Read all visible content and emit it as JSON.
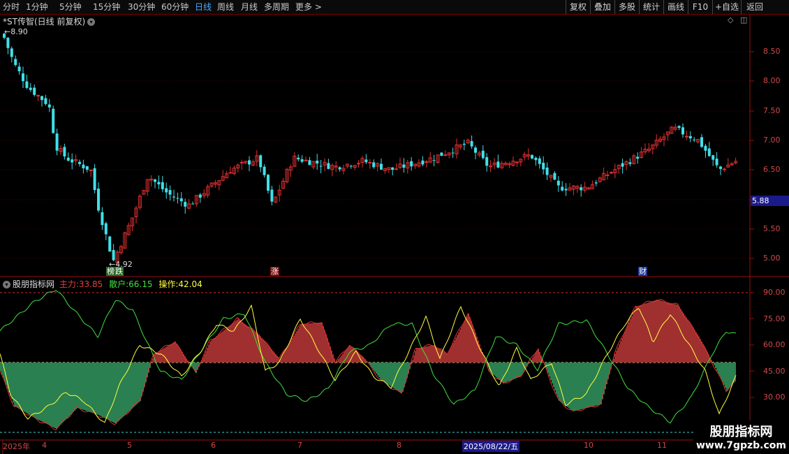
{
  "toolbar": {
    "periods": [
      "分时",
      "1分钟",
      "5分钟",
      "15分钟",
      "30分钟",
      "60分钟",
      "日线",
      "周线",
      "月线",
      "多周期",
      "更多 >"
    ],
    "active_period": "日线",
    "right_buttons": [
      "复权",
      "叠加",
      "多股",
      "统计",
      "画线",
      "F10",
      "+自选",
      "返回"
    ]
  },
  "chart_header": {
    "title": "*ST传智(日线 前复权)",
    "max_marker": "8.90",
    "min_marker": "4.92",
    "price_badge": "5.88"
  },
  "price_axis": [
    "8.50",
    "8.00",
    "7.50",
    "7.00",
    "6.50",
    "5.50",
    "5.00"
  ],
  "event_tags": [
    "榜",
    "跌",
    "涨",
    "财"
  ],
  "indicator": {
    "name": "股朋指标网",
    "main_label": "主力:",
    "main_value": "33.85",
    "retail_label": "散户:",
    "retail_value": "66.15",
    "op_label": "操作:",
    "op_value": "42.04",
    "axis": [
      "90.00",
      "75.00",
      "60.00",
      "45.00",
      "30.00"
    ]
  },
  "date_axis": [
    "2025年",
    "4",
    "5",
    "6",
    "7",
    "8",
    "2025/08/22/五",
    "10",
    "11"
  ],
  "watermark": {
    "title": "股朋指标网",
    "url": "www.7gpzb.com"
  },
  "colors": {
    "up": "#e03030",
    "down": "#40e0e8",
    "main_line": "#ffff40",
    "retail_line": "#40e040",
    "fill_red": "#a03030",
    "fill_green": "#2a8050"
  }
}
